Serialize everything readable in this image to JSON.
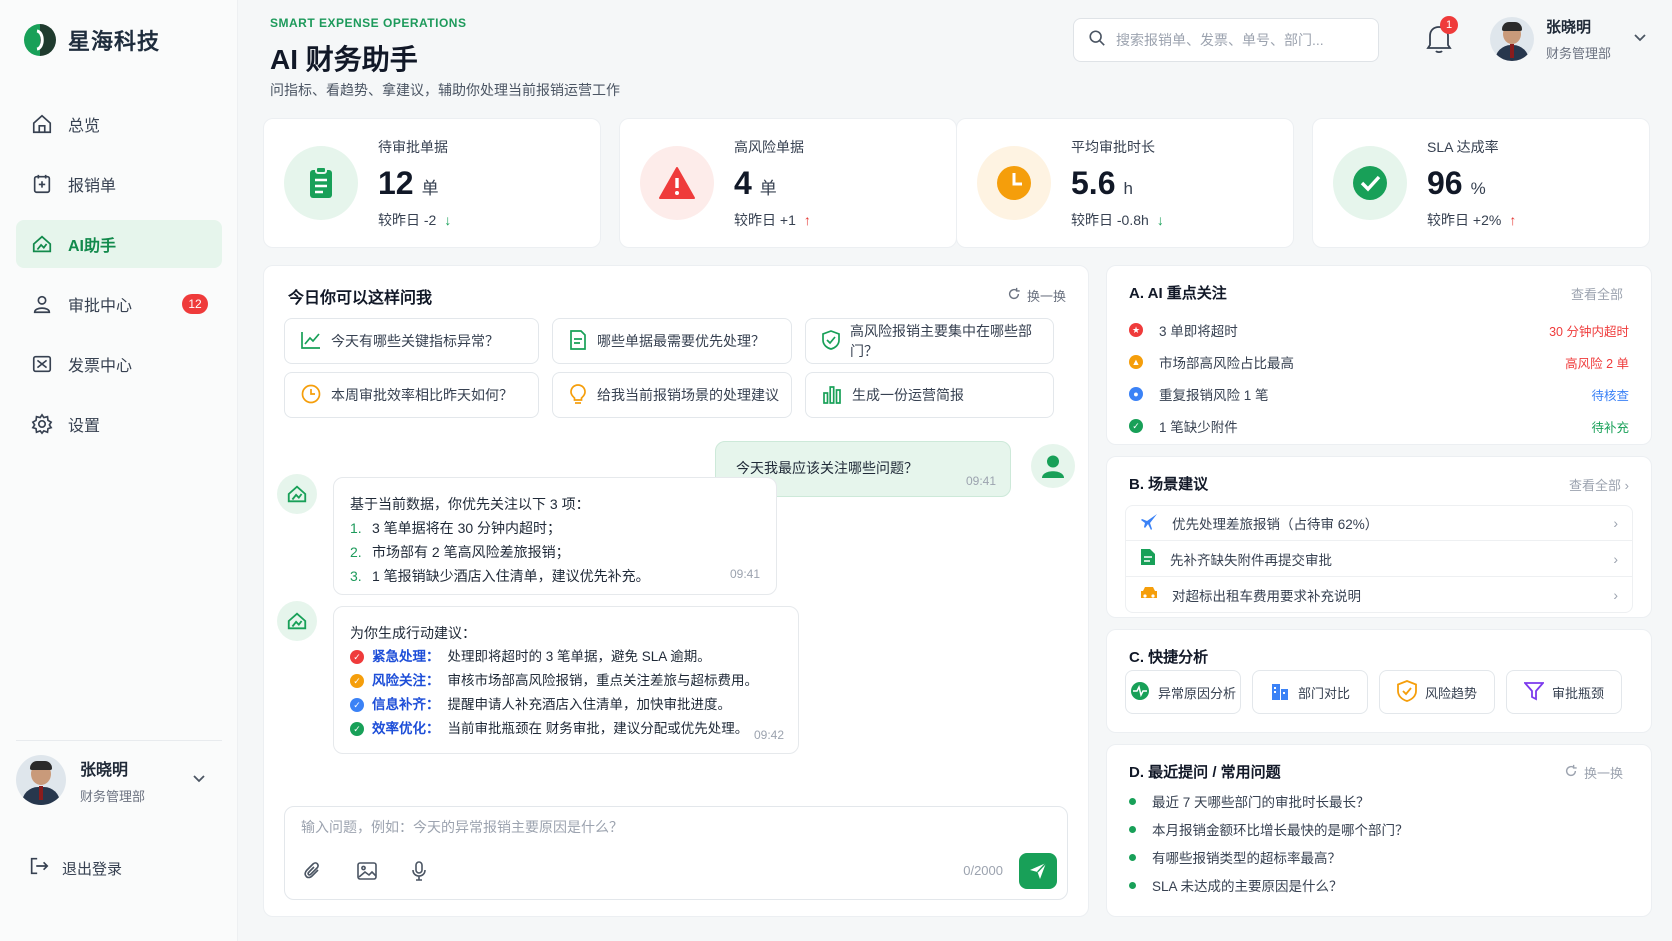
{
  "brand": {
    "name": "星海科技"
  },
  "nav": [
    {
      "label": "总览",
      "icon": "home-icon"
    },
    {
      "label": "报销单",
      "icon": "receipt-icon"
    },
    {
      "label": "AI助手",
      "icon": "ai-assistant-icon",
      "active": true
    },
    {
      "label": "审批中心",
      "icon": "user-icon",
      "badge": "12"
    },
    {
      "label": "发票中心",
      "icon": "invoice-icon"
    },
    {
      "label": "设置",
      "icon": "gear-icon"
    }
  ],
  "sidebar_user": {
    "name": "张晓明",
    "role": "财务管理部"
  },
  "logout": "退出登录",
  "header": {
    "eyebrow": "SMART EXPENSE OPERATIONS",
    "title": "AI 财务助手",
    "subtitle": "问指标、看趋势、拿建议，辅助你处理当前报销运营工作",
    "search_placeholder": "搜索报销单、发票、单号、部门...",
    "notifications": "1",
    "user": {
      "name": "张晓明",
      "role": "财务管理部"
    }
  },
  "kpis": [
    {
      "label": "待审批单据",
      "value": "12",
      "unit": "单",
      "compare": "较昨日 -2",
      "trend": "down",
      "color": "#1d9a5b",
      "bg": "#e6f5ec"
    },
    {
      "label": "高风险单据",
      "value": "4",
      "unit": "单",
      "compare": "较昨日 +1",
      "trend": "up",
      "color": "#ef4444",
      "bg": "#fdecea"
    },
    {
      "label": "平均审批时长",
      "value": "5.6",
      "unit": "h",
      "compare": "较昨日 -0.8h",
      "trend": "down",
      "color": "#f59e0b",
      "bg": "#fef3e2"
    },
    {
      "label": "SLA 达成率",
      "value": "96",
      "unit": "%",
      "compare": "较昨日 +2%",
      "trend": "up",
      "color": "#1d9a5b",
      "bg": "#e6f5ec"
    }
  ],
  "chat": {
    "title": "今日你可以这样问我",
    "refresh": "换一换",
    "suggestions": [
      "今天有哪些关键指标异常？",
      "哪些单据最需要优先处理？",
      "高风险报销主要集中在哪些部门？",
      "本周审批效率相比昨天如何？",
      "给我当前报销场景的处理建议",
      "生成一份运营简报"
    ],
    "user_message": {
      "text": "今天我最应该关注哪些问题？",
      "time": "09:41"
    },
    "bot1": {
      "intro": "基于当前数据，你优先关注以下 3 项：",
      "items": [
        "3 笔单据将在 30 分钟内超时；",
        "市场部有 2 笔高风险差旅报销；",
        "1 笔报销缺少酒店入住清单，建议优先补充。"
      ],
      "time": "09:41"
    },
    "bot2": {
      "intro": "为你生成行动建议：",
      "items": [
        {
          "tag": "紧急处理：",
          "text": "处理即将超时的 3 笔单据，避免 SLA 逾期。",
          "color": "#ef3b3b"
        },
        {
          "tag": "风险关注：",
          "text": "审核市场部高风险报销，重点关注差旅与超标费用。",
          "color": "#f59e0b"
        },
        {
          "tag": "信息补齐：",
          "text": "提醒申请人补充酒店入住清单，加快审批进度。",
          "color": "#3b82f6"
        },
        {
          "tag": "效率优化：",
          "text": "当前审批瓶颈在 财务审批，建议分配或优先处理。",
          "color": "#18a058"
        }
      ],
      "time": "09:42"
    },
    "input_placeholder": "输入问题，例如：今天的异常报销主要原因是什么？",
    "counter": "0/2000"
  },
  "focus": {
    "title": "A. AI 重点关注",
    "link": "查看全部",
    "items": [
      {
        "text": "3 单即将超时",
        "right": "30 分钟内超时",
        "color": "#ef3b3b"
      },
      {
        "text": "市场部高风险占比最高",
        "right": "高风险 2 单",
        "color": "#f59e0b"
      },
      {
        "text": "重复报销风险 1 笔",
        "right": "待核查",
        "color": "#3b82f6"
      },
      {
        "text": "1 笔缺少附件",
        "right": "待补充",
        "color": "#18a058"
      }
    ]
  },
  "scenario": {
    "title": "B. 场景建议",
    "link": "查看全部",
    "items": [
      "优先处理差旅报销（占待审 62%）",
      "先补齐缺失附件再提交审批",
      "对超标出租车费用要求补充说明"
    ]
  },
  "quick": {
    "title": "C. 快捷分析",
    "items": [
      "异常原因分析",
      "部门对比",
      "风险趋势",
      "审批瓶颈"
    ]
  },
  "recent": {
    "title": "D. 最近提问 / 常用问题",
    "refresh": "换一换",
    "items": [
      "最近 7 天哪些部门的审批时长最长？",
      "本月报销金额环比增长最快的是哪个部门？",
      "有哪些报销类型的超标率最高？",
      "SLA 未达成的主要原因是什么？"
    ]
  }
}
